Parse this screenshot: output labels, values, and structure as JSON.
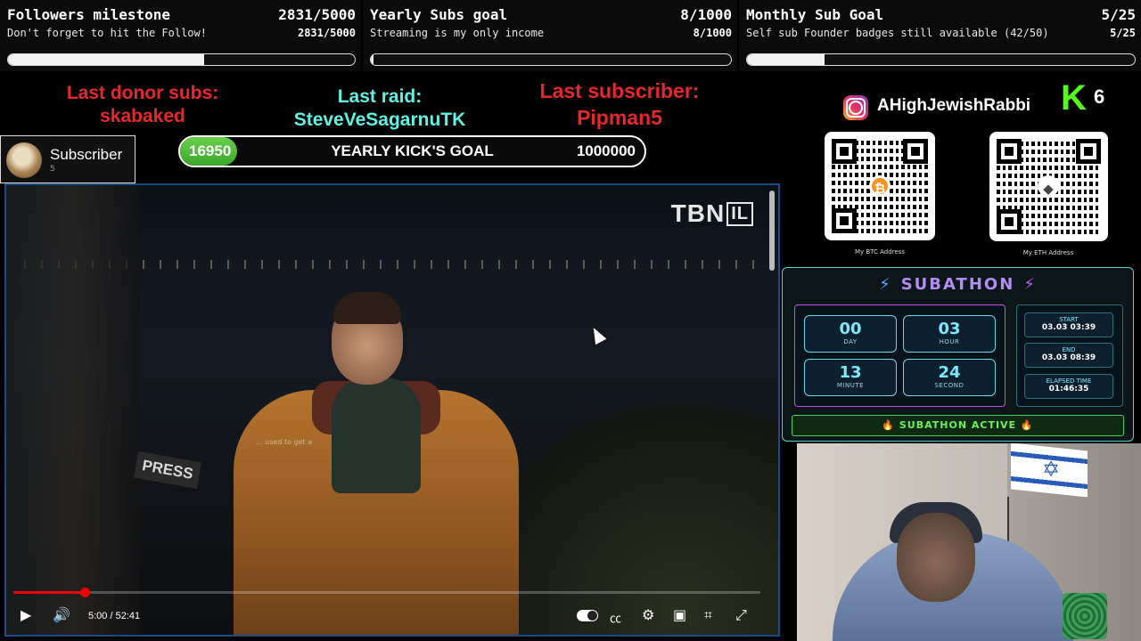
{
  "goals": [
    {
      "title": "Followers milestone",
      "count": "2831/5000",
      "subtitle": "Don't forget to hit the Follow!",
      "count2": "2831/5000",
      "progress": 0.5662
    },
    {
      "title": "Yearly Subs goal",
      "count": "8/1000",
      "subtitle": "Streaming is my only income",
      "count2": "8/1000",
      "progress": 0.008
    },
    {
      "title": "Monthly Sub Goal",
      "count": "5/25",
      "subtitle": "Self sub Founder badges still available (42/50)",
      "count2": "5/25",
      "progress": 0.2
    }
  ],
  "last_events": {
    "donor_label": "Last donor subs:",
    "donor_name": "skabaked",
    "raid_label": "Last raid:",
    "raid_name": "SteveVeSagarnuTK",
    "subscriber_label": "Last subscriber:",
    "subscriber_name": "Pipman5"
  },
  "subscriber_card": {
    "label": "Subscriber",
    "count": "5"
  },
  "kick_goal": {
    "current": "16950",
    "label": "YEARLY KICK'S GOAL",
    "target": "1000000",
    "progress": 0.01695
  },
  "video": {
    "logo": "TBN",
    "logo_suffix": "IL",
    "sign": "PRESS",
    "caption": "... used to get a",
    "time": "5:00 / 52:41",
    "progress": 0.096,
    "icons": {
      "play": "play-icon",
      "volume": "volume-icon",
      "autoplay": "autoplay-toggle",
      "subtitles": "subtitles-icon",
      "settings": "gear-icon",
      "miniplayer": "miniplayer-icon",
      "cast": "cast-icon",
      "fullscreen": "fullscreen-icon"
    }
  },
  "social": {
    "instagram_handle": "AHighJewishRabbi",
    "kick_count": "6",
    "kick_logo": "K"
  },
  "qr": {
    "btc_caption": "My BTC Address",
    "eth_caption": "My ETH Address",
    "btc_symbol": "₿",
    "eth_symbol": "◆"
  },
  "subathon": {
    "title": "SUBATHON",
    "timer": [
      {
        "value": "00",
        "label": "DAY"
      },
      {
        "value": "03",
        "label": "HOUR"
      },
      {
        "value": "13",
        "label": "MINUTE"
      },
      {
        "value": "24",
        "label": "SECOND"
      }
    ],
    "start_label": "START",
    "start_value": "03.03 03:39",
    "end_label": "END",
    "end_value": "03.03 08:39",
    "elapsed_label": "ELAPSED TIME",
    "elapsed_value": "01:46:35",
    "status": "🔥 SUBATHON ACTIVE 🔥"
  },
  "colors": {
    "red": "#e8262b",
    "cyan": "#5ef2e4",
    "kick_green": "#53fc18",
    "accent_purple": "#c54ef0"
  }
}
